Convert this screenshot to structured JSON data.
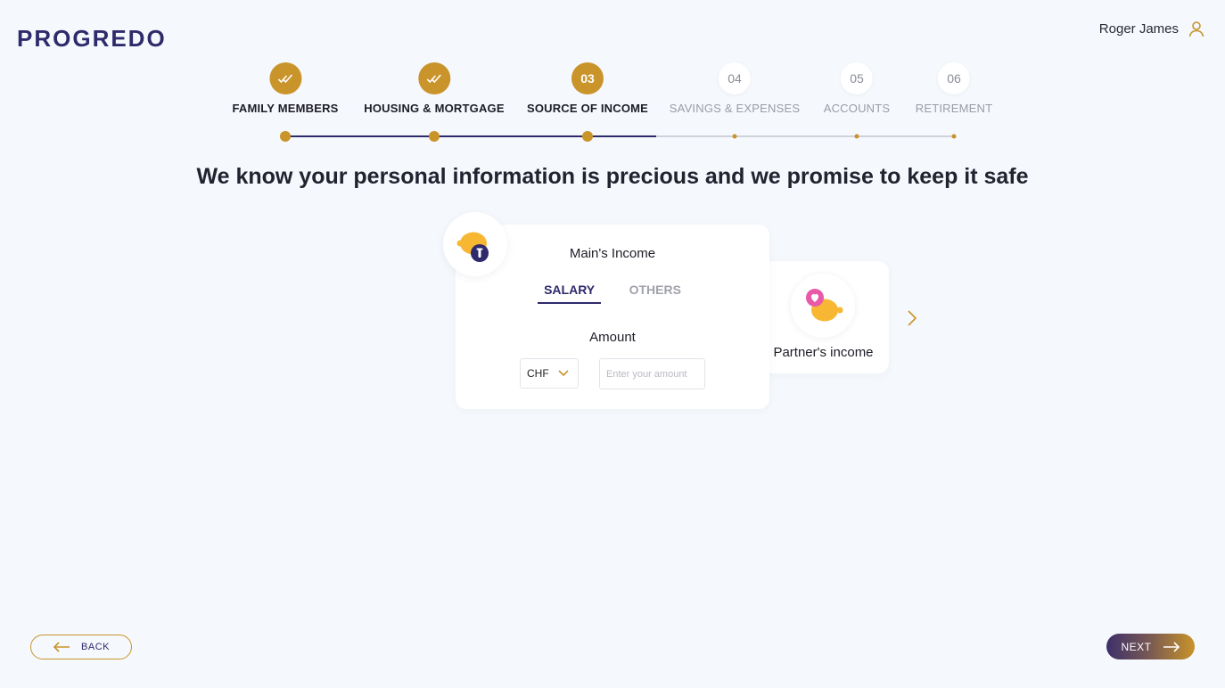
{
  "brand": {
    "logo": "PROGREDO"
  },
  "user": {
    "name": "Roger James",
    "icon": "user-icon"
  },
  "stepper": {
    "steps": [
      {
        "label": "FAMILY MEMBERS",
        "status": "done",
        "marker": ""
      },
      {
        "label": "HOUSING & MORTGAGE",
        "status": "done",
        "marker": ""
      },
      {
        "label": "SOURCE OF INCOME",
        "status": "active",
        "marker": "03"
      },
      {
        "label": "SAVINGS & EXPENSES",
        "status": "pending",
        "marker": "04"
      },
      {
        "label": "ACCOUNTS",
        "status": "pending",
        "marker": "05"
      },
      {
        "label": "RETIREMENT",
        "status": "pending",
        "marker": "06"
      }
    ]
  },
  "headline": "We know your personal information is precious and we promise to keep it safe",
  "main_card": {
    "title": "Main's Income",
    "tabs": [
      {
        "label": "SALARY",
        "active": true
      },
      {
        "label": "OTHERS",
        "active": false
      }
    ],
    "amount_label": "Amount",
    "currency": "CHF",
    "amount_value": "",
    "amount_placeholder": "Enter your amount"
  },
  "partner_card": {
    "label": "Partner's income"
  },
  "nav": {
    "back_label": "BACK",
    "next_label": "NEXT"
  },
  "colors": {
    "accent": "#c9942a",
    "primary": "#2f2a6b",
    "background": "#f5f8fc"
  }
}
